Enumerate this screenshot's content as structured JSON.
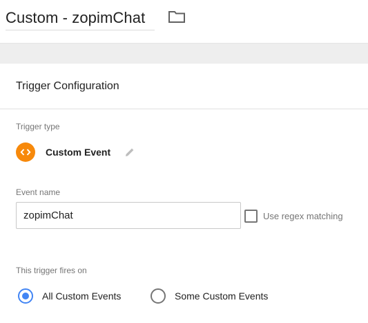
{
  "header": {
    "title": "Custom - zopimChat",
    "folder_icon": "folder-icon"
  },
  "card": {
    "title": "Trigger Configuration",
    "trigger_type": {
      "label": "Trigger type",
      "name": "Custom Event",
      "badge_icon": "custom-event-code-icon",
      "badge_color": "#f7890b",
      "edit_icon": "pencil-icon"
    },
    "event_name": {
      "label": "Event name",
      "value": "zopimChat",
      "regex_label": "Use regex matching",
      "regex_checked": false
    },
    "fires_on": {
      "label": "This trigger fires on",
      "options": [
        "All Custom Events",
        "Some Custom Events"
      ],
      "selected": "All Custom Events"
    }
  },
  "colors": {
    "accent": "#4285f4",
    "badge": "#f7890b"
  }
}
